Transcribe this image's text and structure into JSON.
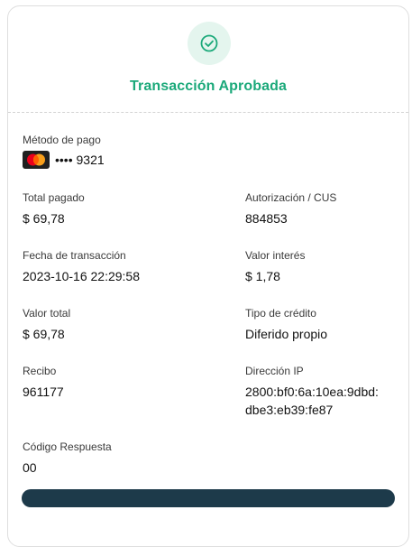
{
  "header": {
    "icon": "check-circle-icon",
    "title": "Transacción Aprobada",
    "accent_color": "#1ba97a"
  },
  "payment_method": {
    "label": "Método de pago",
    "card_brand_icon": "mastercard-icon",
    "card_mask": "•••• 9321"
  },
  "details": {
    "total_paid": {
      "label": "Total pagado",
      "value": "$ 69,78"
    },
    "authorization": {
      "label": "Autorización / CUS",
      "value": "884853"
    },
    "transaction_date": {
      "label": "Fecha de transacción",
      "value": "2023-10-16 22:29:58"
    },
    "interest_value": {
      "label": "Valor interés",
      "value": "$ 1,78"
    },
    "total_value": {
      "label": "Valor total",
      "value": "$ 69,78"
    },
    "credit_type": {
      "label": "Tipo de crédito",
      "value": "Diferido propio"
    },
    "receipt": {
      "label": "Recibo",
      "value": "961177"
    },
    "ip_address": {
      "label": "Dirección IP",
      "value_line1": "2800:bf0:6a:10ea:9dbd:",
      "value_line2": "dbe3:eb39:fe87"
    },
    "response_code": {
      "label": "Código Respuesta",
      "value": "00"
    }
  }
}
